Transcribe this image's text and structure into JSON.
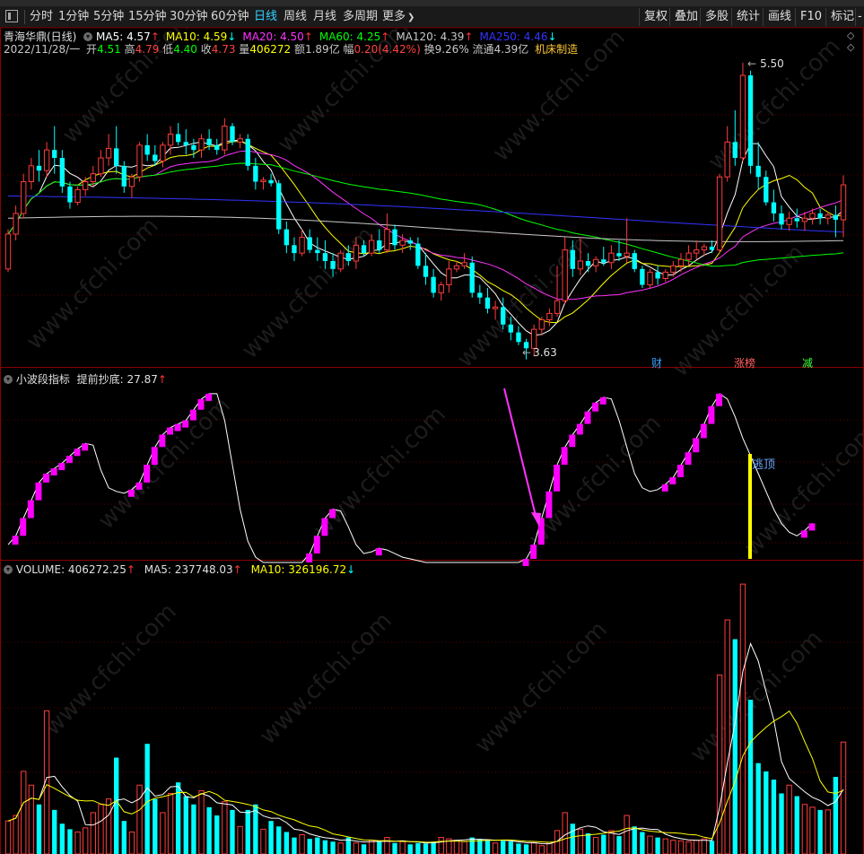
{
  "toolbar": {
    "collapse_icon": "panel-toggle-icon",
    "periods": [
      "分时",
      "1分钟",
      "5分钟",
      "15分钟",
      "30分钟",
      "60分钟",
      "日线",
      "周线",
      "月线",
      "多周期",
      "更多"
    ],
    "active_period": "日线",
    "more_arrow": "❯",
    "right_buttons": [
      "复权",
      "叠加",
      "多股",
      "统计",
      "画线",
      "F10",
      "标记"
    ],
    "overflow": "-"
  },
  "main_panel": {
    "title": "青海华鼎(日线)",
    "ma": [
      {
        "label": "MA5: 4.57",
        "arrow": "↑",
        "arrow_color": "#ff3333",
        "color": "#ffffff"
      },
      {
        "label": "MA10: 4.59",
        "arrow": "↓",
        "arrow_color": "#00ffff",
        "color": "#ffff00"
      },
      {
        "label": "MA20: 4.50",
        "arrow": "↑",
        "arrow_color": "#ff3333",
        "color": "#ff33ff"
      },
      {
        "label": "MA60: 4.25",
        "arrow": "↑",
        "arrow_color": "#ff3333",
        "color": "#00ff00"
      },
      {
        "label": "MA120: 4.39",
        "arrow": "↑",
        "arrow_color": "#ff3333",
        "color": "#c8c8c8"
      },
      {
        "label": "MA250: 4.46",
        "arrow": "↓",
        "arrow_color": "#00ffff",
        "color": "#3333ff"
      }
    ],
    "quote": {
      "date": "2022/11/28/一",
      "open_label": "开",
      "open": "4.51",
      "high_label": "高",
      "high": "4.79",
      "low_label": "低",
      "low": "4.40",
      "close_label": "收",
      "close": "4.73",
      "vol_label": "量",
      "vol": "406272",
      "amt_label": "额",
      "amt": "1.89亿",
      "chg_label": "幅",
      "chg": "0.20(4.42%)",
      "turn_label": "换",
      "turn": "9.26%",
      "float_label": "流通",
      "float": "4.39亿",
      "sector": "机床制造"
    },
    "high_mark": "5.50",
    "low_mark": "3.63",
    "tags": [
      {
        "text": "财",
        "color": "#3aa0ff"
      },
      {
        "text": "涨榜",
        "color": "#ff6060"
      },
      {
        "text": "减",
        "color": "#40ff40"
      }
    ],
    "diamond_icon": "diamond-icon"
  },
  "indicator_panel": {
    "title": "小波段指标",
    "sub": "提前抄底: 27.87",
    "arrow": "↑",
    "escape_label": "逃顶"
  },
  "volume_panel": {
    "vol": "VOLUME: 406272.25",
    "vol_arrow": "↑",
    "ma5": "MA5: 237748.03",
    "ma5_arrow": "↑",
    "ma10": "MA10: 326196.72",
    "ma10_arrow": "↓"
  },
  "watermark": "www.cfchi.com",
  "colors": {
    "up": "#ff3c3c",
    "down": "#00ffff",
    "indicator_bar": "#ff00ff",
    "escape_line": "#ffff00",
    "grid": "#5a0000"
  },
  "chart_data": [
    {
      "type": "candlestick",
      "title": "青海华鼎(日线)",
      "ylim": [
        3.6,
        5.55
      ],
      "ohlc": [
        [
          4.2,
          4.45,
          4.18,
          4.42
        ],
        [
          4.42,
          4.6,
          4.38,
          4.55
        ],
        [
          4.55,
          4.8,
          4.52,
          4.75
        ],
        [
          4.75,
          4.9,
          4.7,
          4.85
        ],
        [
          4.85,
          4.95,
          4.75,
          4.82
        ],
        [
          4.82,
          5.0,
          4.78,
          4.95
        ],
        [
          4.95,
          5.1,
          4.8,
          4.9
        ],
        [
          4.9,
          4.95,
          4.68,
          4.72
        ],
        [
          4.72,
          4.75,
          4.58,
          4.62
        ],
        [
          4.62,
          4.72,
          4.6,
          4.7
        ],
        [
          4.7,
          4.78,
          4.66,
          4.75
        ],
        [
          4.75,
          4.85,
          4.72,
          4.8
        ],
        [
          4.8,
          4.95,
          4.78,
          4.9
        ],
        [
          4.9,
          5.05,
          4.85,
          4.96
        ],
        [
          4.96,
          5.1,
          4.8,
          4.85
        ],
        [
          4.85,
          4.88,
          4.68,
          4.72
        ],
        [
          4.72,
          4.8,
          4.65,
          4.78
        ],
        [
          4.78,
          5.0,
          4.75,
          4.98
        ],
        [
          4.98,
          5.05,
          4.88,
          4.92
        ],
        [
          4.92,
          4.98,
          4.85,
          4.88
        ],
        [
          4.88,
          5.0,
          4.84,
          4.98
        ],
        [
          4.98,
          5.1,
          4.92,
          5.05
        ],
        [
          5.05,
          5.12,
          4.98,
          5.0
        ],
        [
          5.0,
          5.08,
          4.92,
          4.98
        ],
        [
          4.98,
          5.02,
          4.9,
          4.95
        ],
        [
          4.95,
          5.05,
          4.9,
          5.02
        ],
        [
          5.02,
          5.08,
          4.95,
          4.98
        ],
        [
          4.98,
          5.02,
          4.92,
          4.95
        ],
        [
          4.95,
          5.15,
          4.92,
          5.1
        ],
        [
          5.1,
          5.12,
          4.98,
          5.0
        ],
        [
          5.0,
          5.05,
          4.96,
          5.02
        ],
        [
          5.02,
          5.05,
          4.82,
          4.85
        ],
        [
          4.85,
          4.9,
          4.7,
          4.75
        ],
        [
          4.75,
          4.78,
          4.7,
          4.76
        ],
        [
          4.76,
          4.8,
          4.72,
          4.74
        ],
        [
          4.74,
          4.76,
          4.42,
          4.45
        ],
        [
          4.45,
          4.5,
          4.3,
          4.35
        ],
        [
          4.35,
          4.4,
          4.25,
          4.3
        ],
        [
          4.3,
          4.45,
          4.28,
          4.4
        ],
        [
          4.4,
          4.45,
          4.3,
          4.32
        ],
        [
          4.32,
          4.4,
          4.25,
          4.3
        ],
        [
          4.3,
          4.38,
          4.2,
          4.25
        ],
        [
          4.25,
          4.3,
          4.15,
          4.2
        ],
        [
          4.2,
          4.32,
          4.18,
          4.3
        ],
        [
          4.3,
          4.35,
          4.22,
          4.25
        ],
        [
          4.25,
          4.4,
          4.2,
          4.35
        ],
        [
          4.35,
          4.38,
          4.28,
          4.3
        ],
        [
          4.3,
          4.42,
          4.28,
          4.38
        ],
        [
          4.38,
          4.45,
          4.3,
          4.32
        ],
        [
          4.32,
          4.55,
          4.3,
          4.45
        ],
        [
          4.45,
          4.48,
          4.32,
          4.35
        ],
        [
          4.35,
          4.42,
          4.3,
          4.38
        ],
        [
          4.38,
          4.4,
          4.32,
          4.36
        ],
        [
          4.36,
          4.4,
          4.2,
          4.22
        ],
        [
          4.22,
          4.3,
          4.1,
          4.15
        ],
        [
          4.15,
          4.2,
          4.02,
          4.05
        ],
        [
          4.05,
          4.12,
          4.0,
          4.1
        ],
        [
          4.1,
          4.25,
          4.05,
          4.2
        ],
        [
          4.2,
          4.25,
          4.18,
          4.22
        ],
        [
          4.22,
          4.3,
          4.2,
          4.24
        ],
        [
          4.24,
          4.28,
          4.02,
          4.05
        ],
        [
          4.05,
          4.1,
          3.98,
          4.02
        ],
        [
          4.02,
          4.08,
          3.92,
          3.95
        ],
        [
          3.95,
          4.0,
          3.88,
          3.96
        ],
        [
          3.96,
          4.02,
          3.82,
          3.85
        ],
        [
          3.85,
          3.9,
          3.75,
          3.8
        ],
        [
          3.8,
          3.84,
          3.72,
          3.74
        ],
        [
          3.74,
          3.76,
          3.63,
          3.7
        ],
        [
          3.7,
          3.85,
          3.65,
          3.82
        ],
        [
          3.82,
          3.9,
          3.78,
          3.88
        ],
        [
          3.88,
          3.95,
          3.84,
          3.92
        ],
        [
          3.92,
          4.22,
          3.9,
          4.0
        ],
        [
          4.0,
          4.4,
          3.98,
          4.32
        ],
        [
          4.32,
          4.38,
          4.15,
          4.2
        ],
        [
          4.2,
          4.4,
          4.16,
          4.25
        ],
        [
          4.25,
          4.3,
          4.18,
          4.22
        ],
        [
          4.22,
          4.28,
          4.18,
          4.26
        ],
        [
          4.26,
          4.34,
          4.22,
          4.24
        ],
        [
          4.24,
          4.35,
          4.2,
          4.3
        ],
        [
          4.3,
          4.38,
          4.25,
          4.28
        ],
        [
          4.28,
          4.52,
          4.24,
          4.3
        ],
        [
          4.3,
          4.32,
          4.18,
          4.2
        ],
        [
          4.2,
          4.22,
          4.08,
          4.1
        ],
        [
          4.1,
          4.2,
          4.08,
          4.18
        ],
        [
          4.18,
          4.22,
          4.1,
          4.14
        ],
        [
          4.14,
          4.2,
          4.12,
          4.18
        ],
        [
          4.18,
          4.25,
          4.15,
          4.22
        ],
        [
          4.22,
          4.3,
          4.18,
          4.26
        ],
        [
          4.26,
          4.35,
          4.22,
          4.3
        ],
        [
          4.3,
          4.38,
          4.26,
          4.32
        ],
        [
          4.32,
          4.36,
          4.28,
          4.34
        ],
        [
          4.34,
          4.38,
          4.3,
          4.32
        ],
        [
          4.32,
          4.8,
          4.3,
          4.78
        ],
        [
          4.78,
          5.1,
          4.75,
          5.0
        ],
        [
          5.0,
          5.2,
          4.85,
          4.9
        ],
        [
          4.9,
          5.5,
          4.88,
          5.42
        ],
        [
          5.42,
          5.45,
          4.8,
          4.85
        ],
        [
          4.85,
          5.0,
          4.7,
          4.78
        ],
        [
          4.78,
          4.82,
          4.6,
          4.62
        ],
        [
          4.62,
          4.7,
          4.5,
          4.55
        ],
        [
          4.55,
          4.6,
          4.45,
          4.48
        ],
        [
          4.48,
          4.56,
          4.44,
          4.52
        ],
        [
          4.52,
          4.58,
          4.46,
          4.5
        ],
        [
          4.5,
          4.56,
          4.44,
          4.52
        ],
        [
          4.52,
          4.58,
          4.48,
          4.55
        ],
        [
          4.55,
          4.58,
          4.48,
          4.52
        ],
        [
          4.52,
          4.56,
          4.48,
          4.54
        ],
        [
          4.54,
          4.6,
          4.4,
          4.51
        ],
        [
          4.51,
          4.79,
          4.4,
          4.73
        ]
      ]
    },
    {
      "type": "bar",
      "title": "VOLUME",
      "values": [
        120000,
        140000,
        300000,
        250000,
        180000,
        520000,
        160000,
        110000,
        90000,
        80000,
        95000,
        150000,
        180000,
        200000,
        350000,
        120000,
        80000,
        250000,
        400000,
        200000,
        150000,
        220000,
        260000,
        210000,
        180000,
        230000,
        170000,
        140000,
        190000,
        160000,
        100000,
        160000,
        180000,
        90000,
        120000,
        100000,
        80000,
        60000,
        70000,
        55000,
        60000,
        50000,
        45000,
        40000,
        60000,
        40000,
        35000,
        50000,
        45000,
        60000,
        40000,
        45000,
        35000,
        40000,
        38000,
        45000,
        60000,
        55000,
        50000,
        45000,
        60000,
        55000,
        50000,
        40000,
        48000,
        45000,
        38000,
        35000,
        40000,
        30000,
        42000,
        85000,
        150000,
        110000,
        90000,
        75000,
        60000,
        70000,
        85000,
        65000,
        140000,
        100000,
        80000,
        65000,
        60000,
        55000,
        50000,
        48000,
        45000,
        50000,
        55000,
        48000,
        650000,
        850000,
        780000,
        980000,
        560000,
        330000,
        300000,
        270000,
        220000,
        250000,
        210000,
        180000,
        170000,
        160000,
        160000,
        280000,
        406272
      ],
      "ma5": "237748.03",
      "ma10": "326196.72"
    }
  ]
}
